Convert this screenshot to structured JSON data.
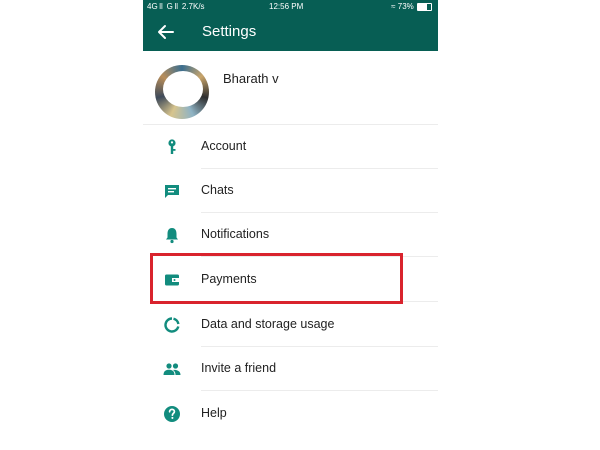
{
  "status_bar": {
    "left": "4G ll  G ll  2.7K/s",
    "time": "12:56 PM",
    "battery": "73%",
    "battery_level": 0.73
  },
  "app_bar": {
    "title": "Settings"
  },
  "profile": {
    "name": "Bharath ᴠ"
  },
  "menu": {
    "items": [
      {
        "label": "Account",
        "icon": "key-icon"
      },
      {
        "label": "Chats",
        "icon": "chat-icon"
      },
      {
        "label": "Notifications",
        "icon": "bell-icon"
      },
      {
        "label": "Payments",
        "icon": "wallet-icon"
      },
      {
        "label": "Data and storage usage",
        "icon": "data-usage-icon"
      },
      {
        "label": "Invite a friend",
        "icon": "people-icon"
      },
      {
        "label": "Help",
        "icon": "help-icon"
      }
    ]
  },
  "colors": {
    "header": "#075e54",
    "icon": "#128c7e",
    "highlight_box": "#d9232d"
  }
}
